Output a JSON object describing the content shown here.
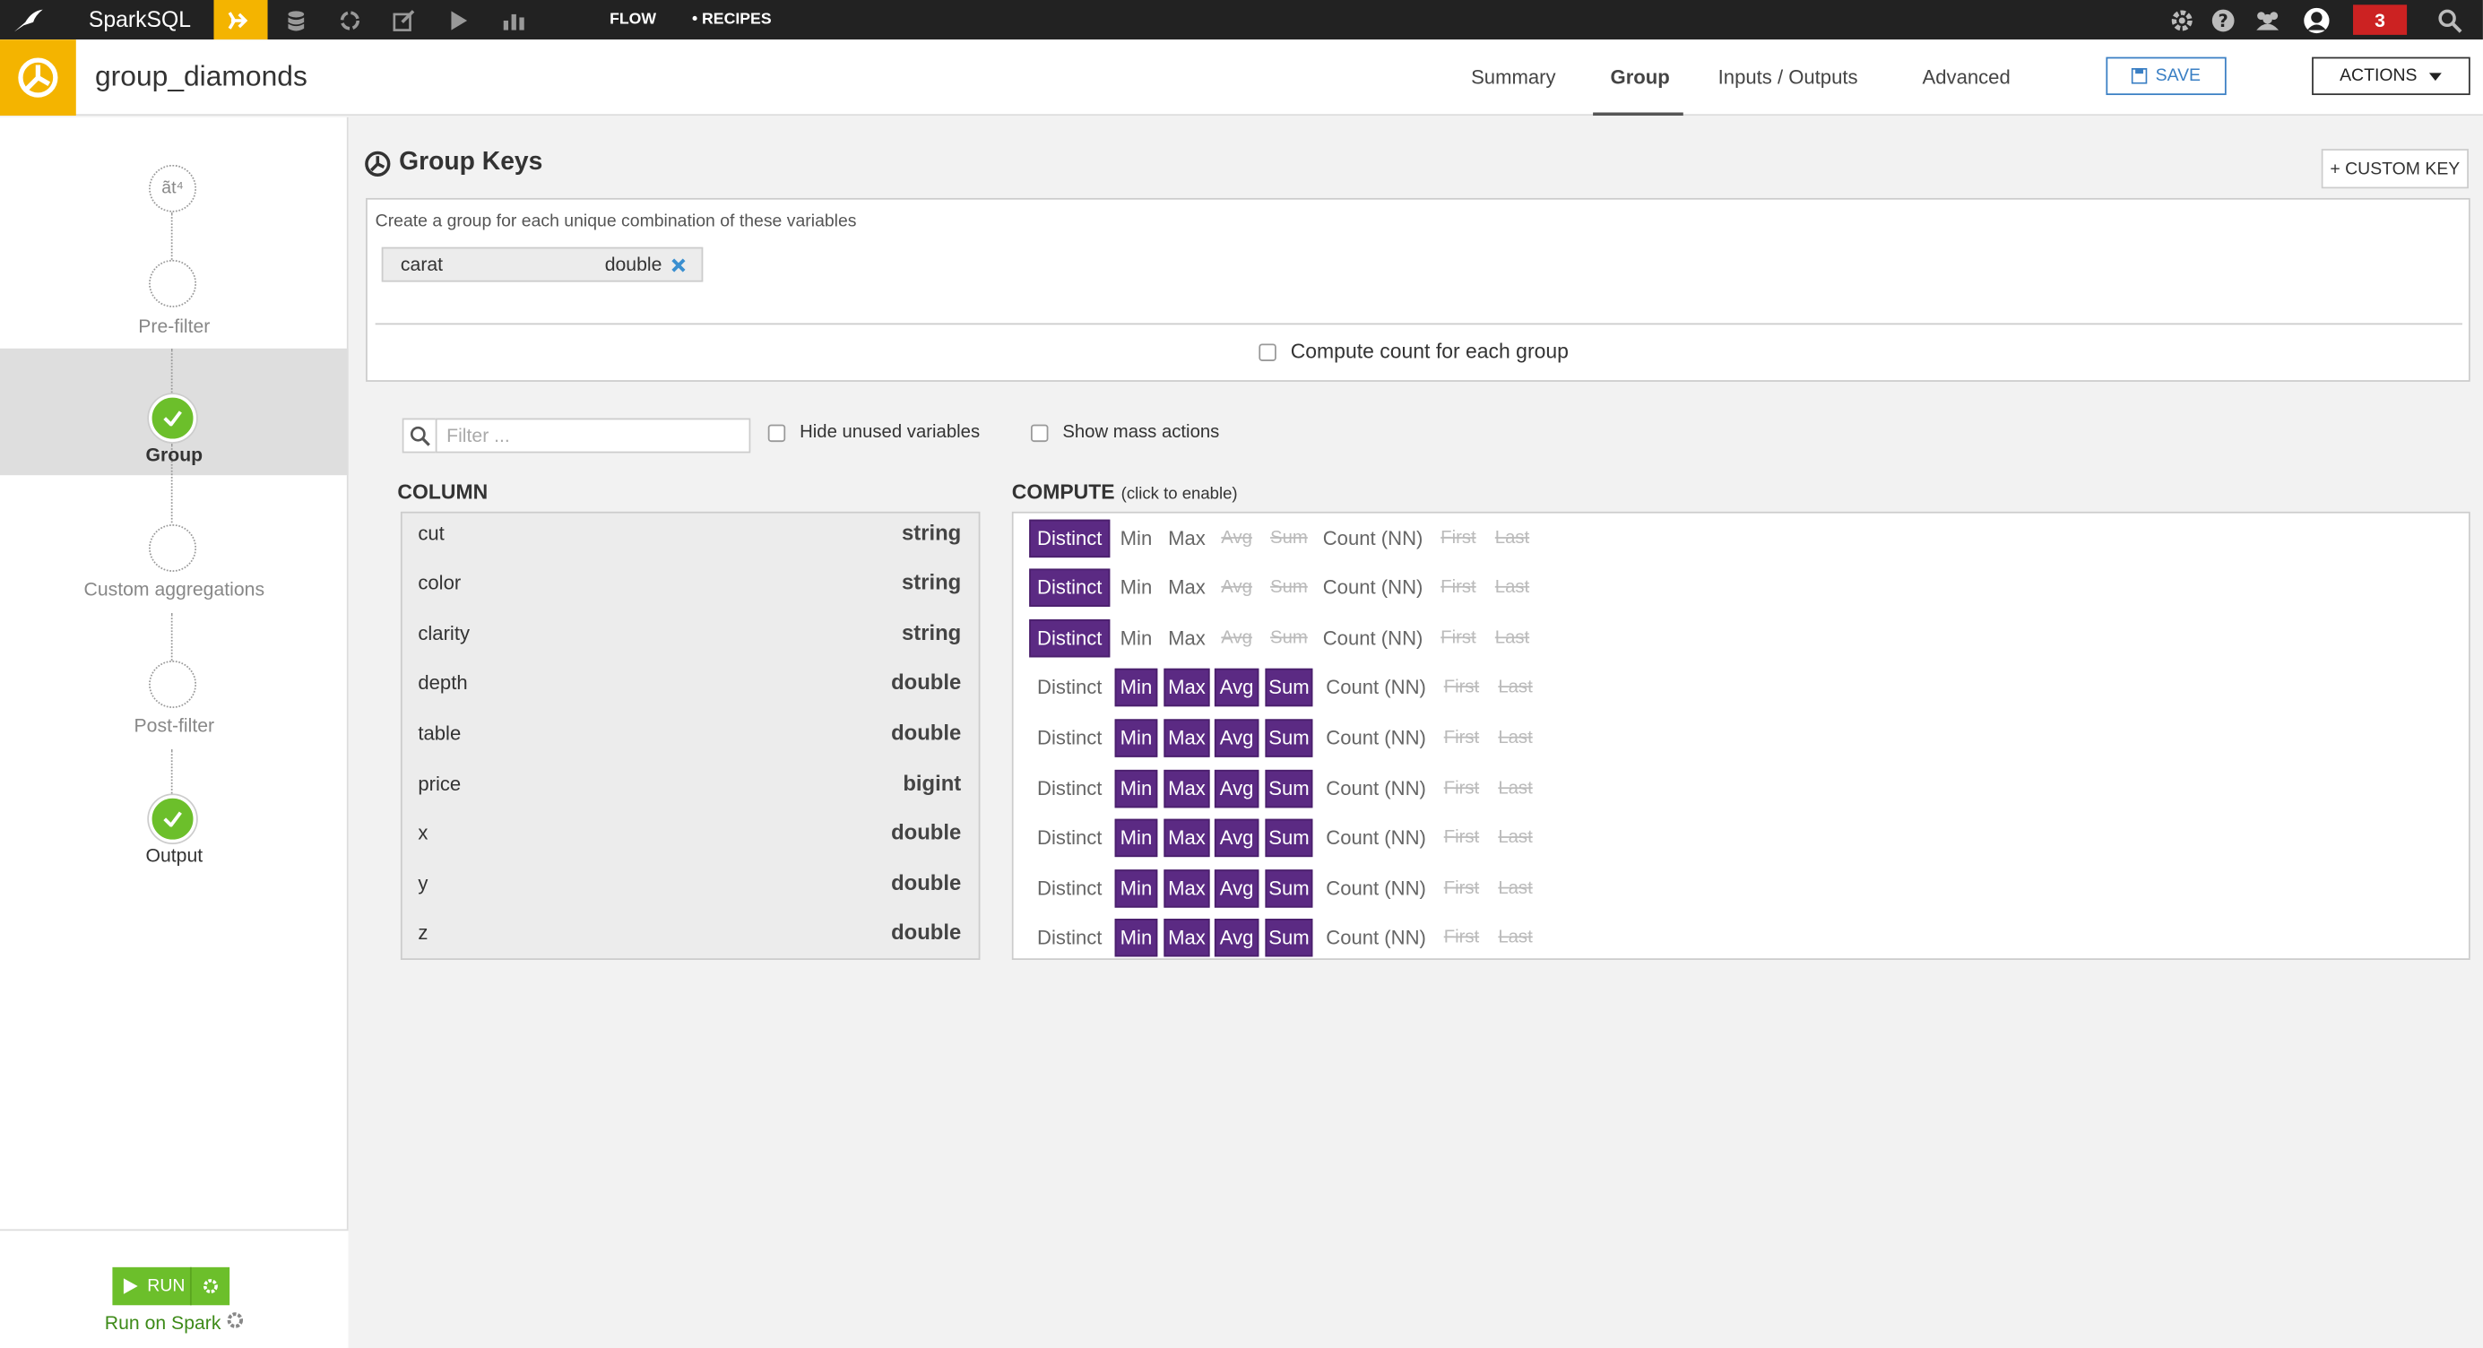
{
  "app": {
    "name": "SparkSQL",
    "nav_flow": "FLOW",
    "nav_recipes": "• RECIPES",
    "notif_count": "3"
  },
  "header": {
    "title": "group_diamonds",
    "tabs": [
      "Summary",
      "Group",
      "Inputs / Outputs",
      "Advanced"
    ],
    "active_tab": "Group",
    "save_label": "SAVE",
    "actions_label": "ACTIONS"
  },
  "sidebar": {
    "steps": [
      "Pre-filter",
      "Group",
      "Custom aggregations",
      "Post-filter",
      "Output"
    ],
    "selected": "Group",
    "run_label": "RUN",
    "run_engine": "Run on Spark"
  },
  "group_keys": {
    "title": "Group Keys",
    "custom_key_label": "+ CUSTOM KEY",
    "description": "Create a group for each unique combination of these variables",
    "keys": [
      {
        "name": "carat",
        "type": "double"
      }
    ],
    "compute_count_label": "Compute count for each group"
  },
  "filters": {
    "placeholder": "Filter ...",
    "hide_unused_label": "Hide unused variables",
    "mass_actions_label": "Show mass actions"
  },
  "column_header": "COLUMN",
  "compute_header": "COMPUTE",
  "compute_hint": "(click to enable)",
  "agg_labels": [
    "Distinct",
    "Min",
    "Max",
    "Avg",
    "Sum",
    "Count (NN)",
    "First",
    "Last"
  ],
  "columns": [
    {
      "name": "cut",
      "type": "string",
      "enabled": [
        "Distinct"
      ]
    },
    {
      "name": "color",
      "type": "string",
      "enabled": [
        "Distinct"
      ]
    },
    {
      "name": "clarity",
      "type": "string",
      "enabled": [
        "Distinct"
      ]
    },
    {
      "name": "depth",
      "type": "double",
      "enabled": [
        "Min",
        "Max",
        "Avg",
        "Sum"
      ]
    },
    {
      "name": "table",
      "type": "double",
      "enabled": [
        "Min",
        "Max",
        "Avg",
        "Sum"
      ]
    },
    {
      "name": "price",
      "type": "bigint",
      "enabled": [
        "Min",
        "Max",
        "Avg",
        "Sum"
      ]
    },
    {
      "name": "x",
      "type": "double",
      "enabled": [
        "Min",
        "Max",
        "Avg",
        "Sum"
      ]
    },
    {
      "name": "y",
      "type": "double",
      "enabled": [
        "Min",
        "Max",
        "Avg",
        "Sum"
      ]
    },
    {
      "name": "z",
      "type": "double",
      "enabled": [
        "Min",
        "Max",
        "Avg",
        "Sum"
      ]
    }
  ],
  "colors": {
    "accent": "#f4b400",
    "enabled_agg": "#5b2a83",
    "run": "#6cbf2b",
    "save": "#3a7fc4",
    "alert": "#cc2222"
  }
}
